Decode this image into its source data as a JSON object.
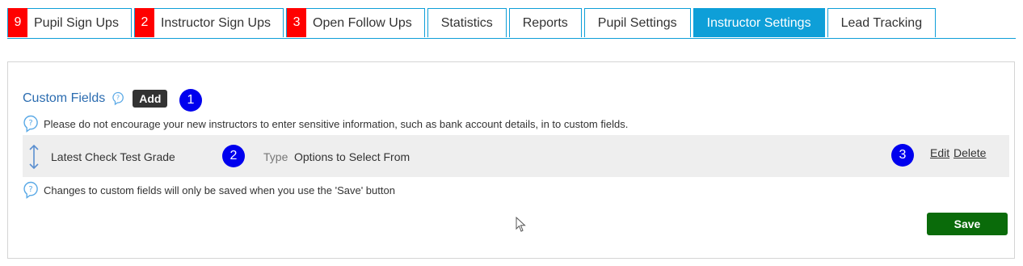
{
  "tabs": [
    {
      "badge": "9",
      "label": "Pupil Sign Ups"
    },
    {
      "badge": "2",
      "label": "Instructor Sign Ups"
    },
    {
      "badge": "3",
      "label": "Open Follow Ups"
    },
    {
      "label": "Statistics"
    },
    {
      "label": "Reports"
    },
    {
      "label": "Pupil Settings"
    },
    {
      "label": "Instructor Settings",
      "active": true
    },
    {
      "label": "Lead Tracking"
    }
  ],
  "custom_fields": {
    "title": "Custom Fields",
    "add_label": "Add",
    "warning_note": "Please do not encourage your new instructors to enter sensitive information, such as bank account details, in to custom fields.",
    "fields": [
      {
        "name": "Latest Check Test Grade",
        "type_label": "Type",
        "type_value": "Options to Select From",
        "edit_label": "Edit",
        "delete_label": "Delete"
      }
    ],
    "save_note": "Changes to custom fields will only be saved when you use the 'Save' button",
    "save_label": "Save"
  },
  "markers": {
    "m1": "1",
    "m2": "2",
    "m3": "3"
  },
  "colors": {
    "accent": "#0e9fd8",
    "badge": "#ff0000",
    "marker": "#0000ee",
    "save": "#0a6b0a"
  }
}
